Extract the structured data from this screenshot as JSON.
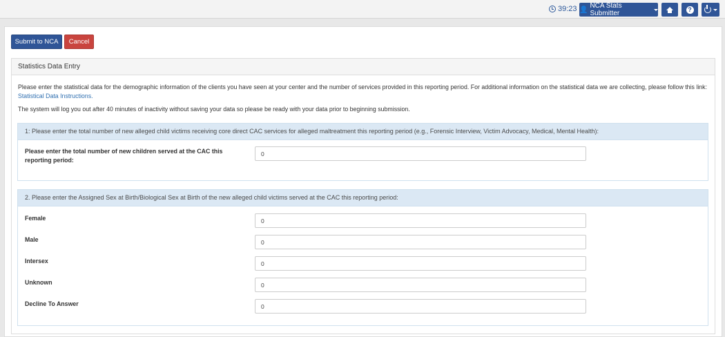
{
  "header": {
    "timer": "39:23",
    "user_menu": "NCA Stats Submitter",
    "icons": {
      "timer": "clock-icon",
      "user": "user-icon",
      "home": "home-icon",
      "help": "help-icon",
      "power": "power-icon"
    }
  },
  "actions": {
    "submit": "Submit to NCA",
    "cancel": "Cancel"
  },
  "panel": {
    "title": "Statistics Data Entry",
    "intro_text": "Please enter the statistical data for the demographic information of the clients you have seen at your center and the number of services provided in this reporting period. For additional information on the statistical data we are collecting, please follow this link: ",
    "intro_link": "Statistical Data Instructions.",
    "logout_notice": "The system will log you out after 40 minutes of inactivity without saving your data so please be ready with your data prior to beginning submission."
  },
  "section1": {
    "heading": "1: Please enter the total number of new alleged child victims receiving core direct CAC services for alleged maltreatment this reporting period (e.g., Forensic Interview, Victim Advocacy, Medical, Mental Health):",
    "label": "Please enter the total number of new children served at the CAC this reporting period:",
    "value": "0"
  },
  "section2": {
    "heading": "2. Please enter the Assigned Sex at Birth/Biological Sex at Birth of the new alleged child victims served at the CAC this reporting period:",
    "fields": [
      {
        "label": "Female",
        "value": "0"
      },
      {
        "label": "Male",
        "value": "0"
      },
      {
        "label": "Intersex",
        "value": "0"
      },
      {
        "label": "Unknown",
        "value": "0"
      },
      {
        "label": "Decline To Answer",
        "value": "0"
      }
    ]
  },
  "colors": {
    "primary": "#2f5597",
    "danger": "#c9443e",
    "section_header": "#dbe8f4",
    "link": "#2f6fb0"
  }
}
